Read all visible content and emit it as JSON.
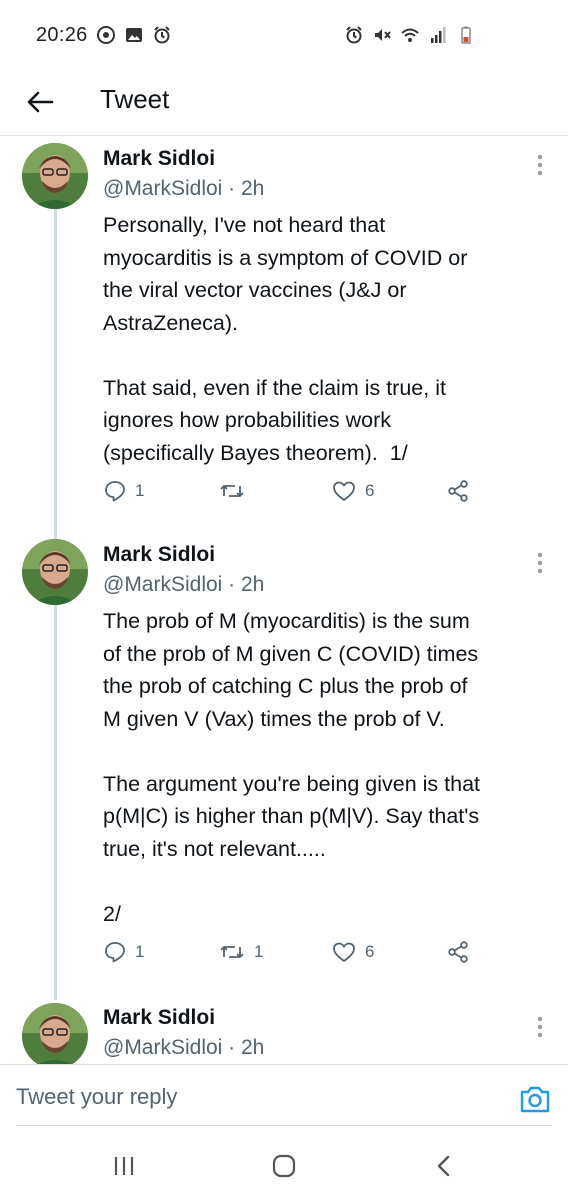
{
  "status_bar": {
    "time": "20:26",
    "left_icons": [
      "whatsapp-icon",
      "gallery-icon",
      "alarm-icon"
    ],
    "right_icons": [
      "alarm-icon",
      "mute-icon",
      "wifi-icon",
      "signal-icon",
      "battery-icon"
    ]
  },
  "header": {
    "title": "Tweet",
    "back_icon": "arrow-left-icon"
  },
  "tweets": [
    {
      "author": "Mark Sidloi",
      "handle": "@MarkSidloi · 2h",
      "text": "Personally, I've not heard that\nmyocarditis is a symptom of COVID or\nthe viral vector vaccines (J&J or\nAstraZeneca).\n\nThat said, even if the claim is true, it\nignores how probabilities work\n(specifically Bayes theorem).  1/",
      "replies": "1",
      "retweets": "",
      "likes": "6"
    },
    {
      "author": "Mark Sidloi",
      "handle": "@MarkSidloi · 2h",
      "text": "The prob of M (myocarditis) is the sum\nof the prob of M given C (COVID) times\nthe prob of catching C plus the prob of\nM given V (Vax) times the prob of V.\n\nThe argument you're being given is that\np(M|C) is higher than p(M|V). Say that's\ntrue, it's not relevant.....\n\n2/",
      "replies": "1",
      "retweets": "1",
      "likes": "6"
    },
    {
      "author": "Mark Sidloi",
      "handle": "@MarkSidloi · 2h",
      "text": "",
      "replies": "",
      "retweets": "",
      "likes": ""
    }
  ],
  "reply": {
    "placeholder": "Tweet your reply"
  },
  "colors": {
    "accent": "#1d9bf0",
    "text": "#0f1419",
    "secondary": "#536471",
    "thread_line": "#cfd9de"
  }
}
